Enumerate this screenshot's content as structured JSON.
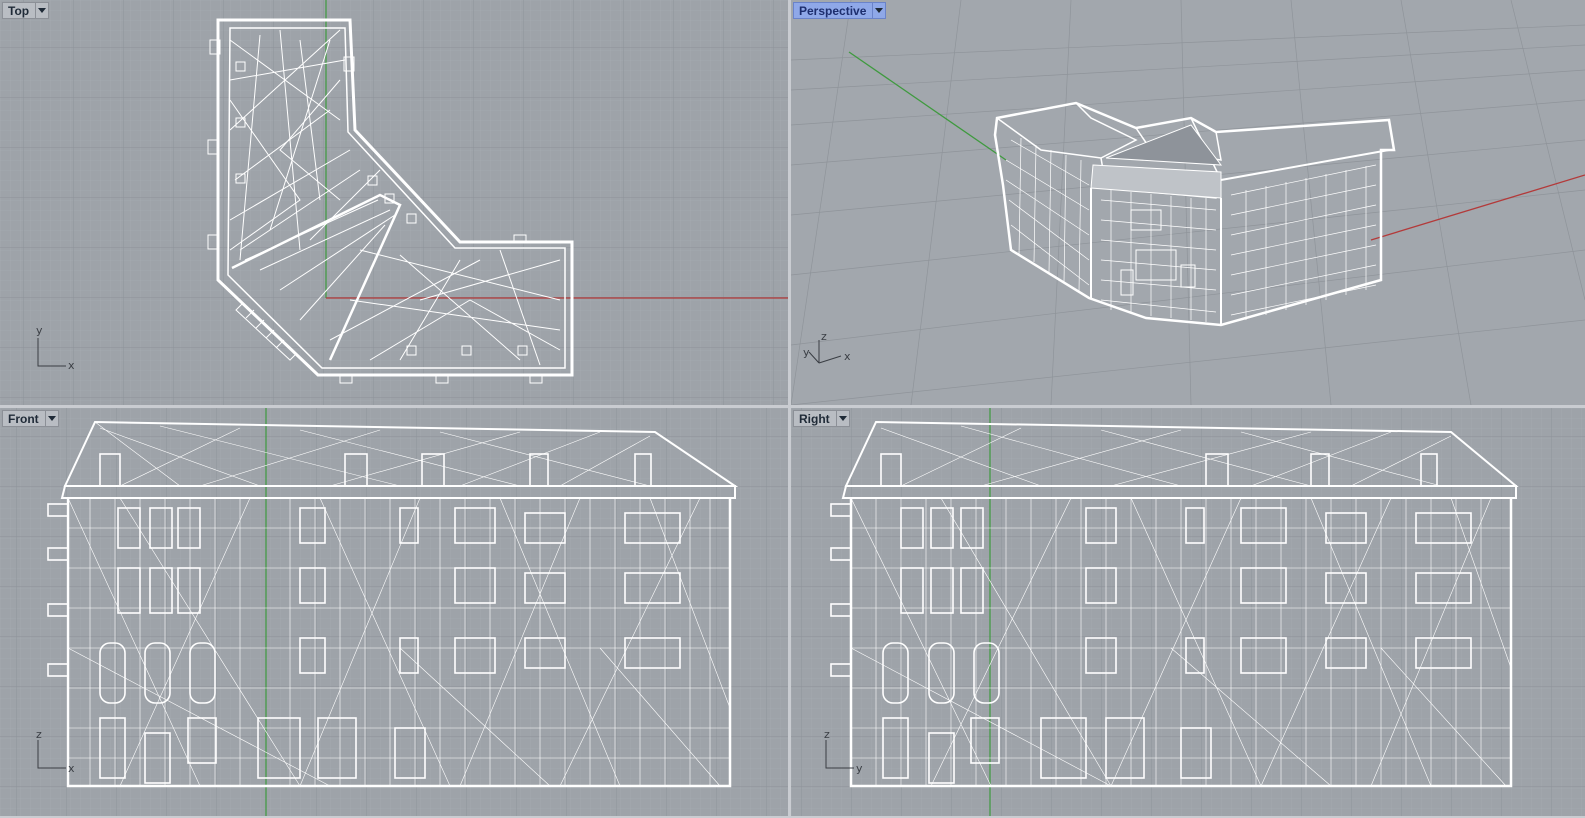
{
  "viewports": {
    "top": {
      "label": "Top",
      "axes": [
        "y",
        "x"
      ]
    },
    "persp": {
      "label": "Perspective",
      "axes": [
        "z",
        "y",
        "x"
      ],
      "active": true
    },
    "front": {
      "label": "Front",
      "axes": [
        "z",
        "x"
      ]
    },
    "right": {
      "label": "Right",
      "axes": [
        "z",
        "y"
      ]
    }
  },
  "colors": {
    "viewport_bg": "#9ea3a9",
    "grid_minor": "#a8adb3",
    "grid_major": "#8d9299",
    "x_axis": "#b33a3a",
    "y_axis": "#3f9a3f",
    "wire": "#ffffff",
    "active_title": "#8fa8e8"
  },
  "icons": {
    "viewport_menu": "chevron-down-icon",
    "axis_widget": "axis-triad-icon"
  }
}
